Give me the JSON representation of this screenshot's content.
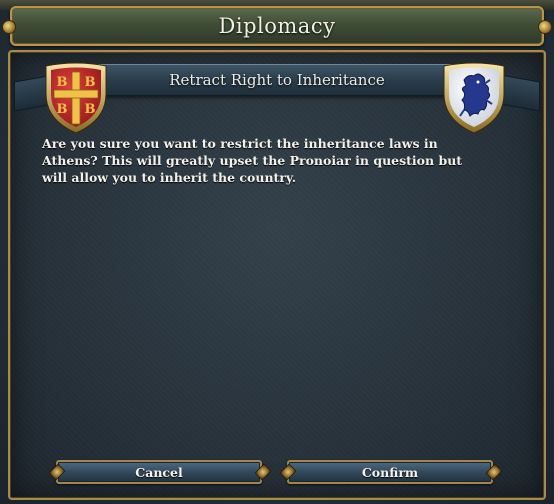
{
  "window": {
    "title": "Diplomacy"
  },
  "dialog": {
    "subtitle": "Retract Right to Inheritance",
    "message": "Are you sure you want to restrict the inheritance laws in Athens? This will greatly upset the Pronoiar in question but will allow you to inherit the country.",
    "left_shield": {
      "icon": "byzantine-tetragrammatic-cross-shield-icon",
      "field_color": "#b8262a",
      "charge_color": "#e6b73c"
    },
    "right_shield": {
      "icon": "blue-lion-rampant-shield-icon",
      "field_color": "#eef1f4",
      "charge_color": "#243a8c"
    }
  },
  "buttons": {
    "cancel_label": "Cancel",
    "confirm_label": "Confirm"
  }
}
